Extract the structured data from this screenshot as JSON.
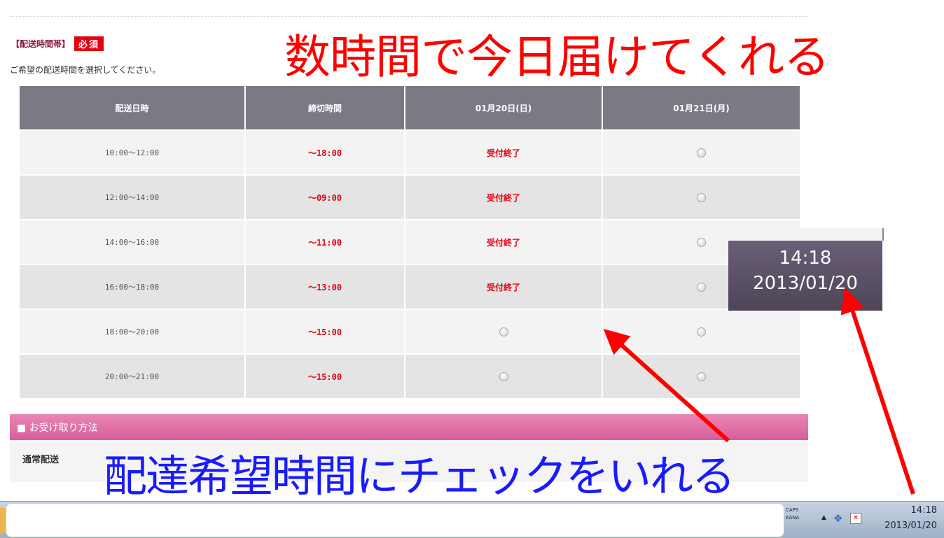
{
  "delivery_section": {
    "title": "【配送時間帯】",
    "required_badge": "必須",
    "instruction": "ご希望の配送時間を選択してください。"
  },
  "slot_table": {
    "headers": [
      "配送日時",
      "締切時間",
      "01月20日(日)",
      "01月21日(月)"
    ],
    "rows": [
      {
        "time": "10:00～12:00",
        "deadline": "～18:00",
        "day1": "受付終了",
        "day2": "radio"
      },
      {
        "time": "12:00～14:00",
        "deadline": "～09:00",
        "day1": "受付終了",
        "day2": "radio"
      },
      {
        "time": "14:00～16:00",
        "deadline": "～11:00",
        "day1": "受付終了",
        "day2": "radio"
      },
      {
        "time": "16:00～18:00",
        "deadline": "～13:00",
        "day1": "受付終了",
        "day2": "radio"
      },
      {
        "time": "18:00～20:00",
        "deadline": "～15:00",
        "day1": "radio",
        "day2": "radio"
      },
      {
        "time": "20:00～21:00",
        "deadline": "～15:00",
        "day1": "radio",
        "day2": "radio"
      }
    ]
  },
  "receive_section": {
    "title": "■ お受け取り方法",
    "method": "通常配送"
  },
  "overlay": {
    "red_caption": "数時間で今日届けてくれる",
    "blue_caption": "配達希望時間にチェックをいれる",
    "zoom_time": "14:18",
    "zoom_date": "2013/01/20"
  },
  "taskbar": {
    "caps_label": "CAPS",
    "kana_label": "KANA",
    "clock_time": "14:18",
    "clock_date": "2013/01/20"
  },
  "colors": {
    "accent_red": "#e60012",
    "header_gray": "#7b7984",
    "pink_bar": "#e070a8",
    "annotation_red": "#ff0000",
    "annotation_blue": "#1a1aff"
  }
}
